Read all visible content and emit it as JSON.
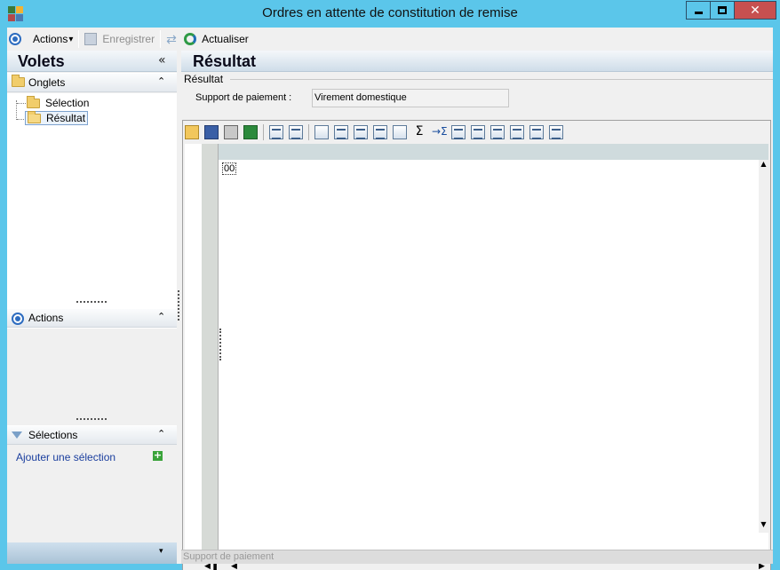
{
  "window": {
    "title": "Ordres en attente de constitution de remise",
    "close_glyph": "✕"
  },
  "toolbar": {
    "actions_label": "Actions",
    "actions_arrow": "▾",
    "save_label": "Enregistrer",
    "refresh_label": "Actualiser"
  },
  "left_panel": {
    "title": "Volets",
    "collapse_glyph": "«",
    "tabs_section": {
      "label": "Onglets",
      "chevron": "⌃",
      "items": [
        {
          "label": "Sélection"
        },
        {
          "label": "Résultat"
        }
      ]
    },
    "actions_section": {
      "label": "Actions",
      "chevron": "⌃"
    },
    "selections_section": {
      "label": "Sélections",
      "chevron": "⌃",
      "add_label": "Ajouter une sélection",
      "add_glyph": "+"
    },
    "footer_chevron": "▾"
  },
  "result_panel": {
    "title": "Résultat",
    "group_label": "Résultat",
    "field_label": "Support de paiement :",
    "field_value": "Virement domestique"
  },
  "grid": {
    "cell_value": "00",
    "sigma_glyph": "Σ",
    "arrow_glyph": "→Σ",
    "scroll_up": "▲",
    "scroll_down": "▼",
    "nav_glyph": "◀▐",
    "scroll_left": "◀",
    "scroll_right": "▶"
  },
  "status": {
    "text": "Support de paiement"
  },
  "colors": {
    "frame": "#5bc6ea",
    "close_button": "#c75050",
    "link": "#1a3e9e"
  }
}
